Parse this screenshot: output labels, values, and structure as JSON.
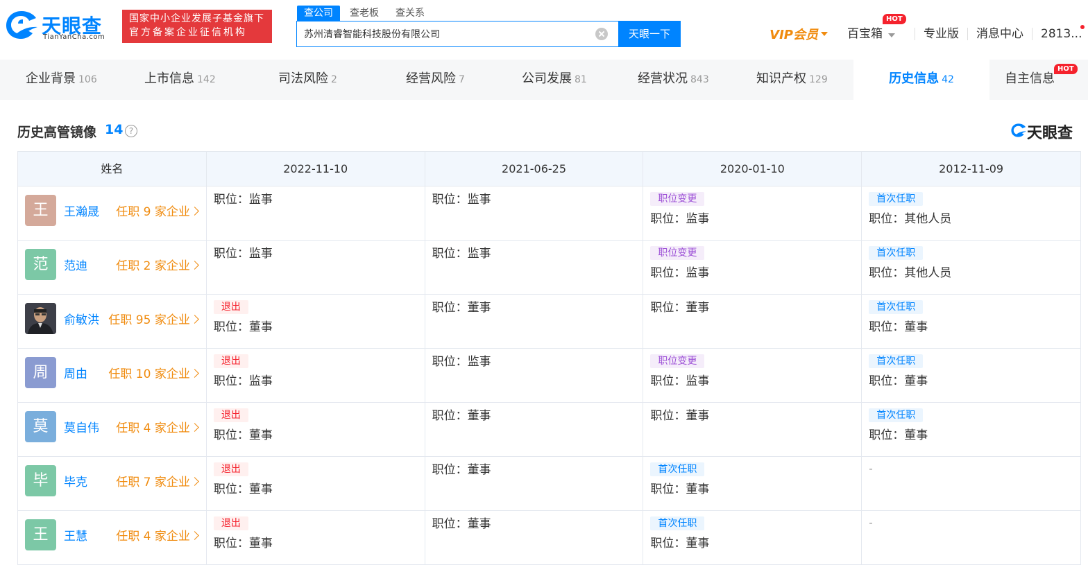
{
  "header": {
    "logo_cn": "天眼查",
    "logo_en": "TianYanCha.com",
    "gov_badge_line1": "国家中小企业发展子基金旗下",
    "gov_badge_line2": "官方备案企业征信机构",
    "search_tabs": [
      "查公司",
      "查老板",
      "查关系"
    ],
    "search_value": "苏州清睿智能科技股份有限公司",
    "search_button": "天眼一下",
    "vip": "VIP会员",
    "treasure": "百宝箱",
    "hot_label": "HOT",
    "pro": "专业版",
    "messages": "消息中心",
    "user": "2813..."
  },
  "tabs": [
    {
      "label": "企业背景",
      "count": "106"
    },
    {
      "label": "上市信息",
      "count": "142"
    },
    {
      "label": "司法风险",
      "count": "2"
    },
    {
      "label": "经营风险",
      "count": "7"
    },
    {
      "label": "公司发展",
      "count": "81"
    },
    {
      "label": "经营状况",
      "count": "843"
    },
    {
      "label": "知识产权",
      "count": "129"
    },
    {
      "label": "历史信息",
      "count": "42"
    },
    {
      "label": "自主信息",
      "count": ""
    }
  ],
  "section": {
    "title": "历史高管镜像",
    "count": "14",
    "help": "?",
    "brand": "天眼查"
  },
  "table": {
    "headers": [
      "姓名",
      "2022-11-10",
      "2021-06-25",
      "2020-01-10",
      "2012-11-09"
    ],
    "rows": [
      {
        "avatar_char": "王",
        "avatar_color": "#d4a99a",
        "name": "王瀚晟",
        "jobs": "任职 9 家企业",
        "cells": [
          {
            "tag": "",
            "pos": "职位：监事"
          },
          {
            "tag": "",
            "pos": "职位：监事"
          },
          {
            "tag": "职位变更",
            "pos": "职位：监事"
          },
          {
            "tag": "首次任职",
            "pos": "职位：其他人员"
          }
        ]
      },
      {
        "avatar_char": "范",
        "avatar_color": "#7cc8a6",
        "name": "范迪",
        "jobs": "任职 2 家企业",
        "cells": [
          {
            "tag": "",
            "pos": "职位：监事"
          },
          {
            "tag": "",
            "pos": "职位：监事"
          },
          {
            "tag": "职位变更",
            "pos": "职位：监事"
          },
          {
            "tag": "首次任职",
            "pos": "职位：其他人员"
          }
        ]
      },
      {
        "avatar_char": "",
        "avatar_color": "#4a4a55",
        "name": "俞敏洪",
        "jobs": "任职 95 家企业",
        "cells": [
          {
            "tag": "退出",
            "pos": "职位：董事"
          },
          {
            "tag": "",
            "pos": "职位：董事"
          },
          {
            "tag": "",
            "pos": "职位：董事"
          },
          {
            "tag": "首次任职",
            "pos": "职位：董事"
          }
        ]
      },
      {
        "avatar_char": "周",
        "avatar_color": "#8a9bd1",
        "name": "周由",
        "jobs": "任职 10 家企业",
        "cells": [
          {
            "tag": "退出",
            "pos": "职位：监事"
          },
          {
            "tag": "",
            "pos": "职位：监事"
          },
          {
            "tag": "职位变更",
            "pos": "职位：监事"
          },
          {
            "tag": "首次任职",
            "pos": "职位：董事"
          }
        ]
      },
      {
        "avatar_char": "莫",
        "avatar_color": "#7aaedc",
        "name": "莫自伟",
        "jobs": "任职 4 家企业",
        "cells": [
          {
            "tag": "退出",
            "pos": "职位：董事"
          },
          {
            "tag": "",
            "pos": "职位：董事"
          },
          {
            "tag": "",
            "pos": "职位：董事"
          },
          {
            "tag": "首次任职",
            "pos": "职位：董事"
          }
        ]
      },
      {
        "avatar_char": "毕",
        "avatar_color": "#7cc8a6",
        "name": "毕克",
        "jobs": "任职 7 家企业",
        "cells": [
          {
            "tag": "退出",
            "pos": "职位：董事"
          },
          {
            "tag": "",
            "pos": "职位：董事"
          },
          {
            "tag": "首次任职",
            "pos": "职位：董事"
          },
          {
            "tag": "",
            "pos": "-"
          }
        ]
      },
      {
        "avatar_char": "王",
        "avatar_color": "#7cc8a6",
        "name": "王慧",
        "jobs": "任职 4 家企业",
        "cells": [
          {
            "tag": "退出",
            "pos": "职位：董事"
          },
          {
            "tag": "",
            "pos": "职位：董事"
          },
          {
            "tag": "首次任职",
            "pos": "职位：董事"
          },
          {
            "tag": "",
            "pos": "-"
          }
        ]
      }
    ]
  },
  "tag_colors": {
    "退出": "exit",
    "职位变更": "change",
    "首次任职": "first"
  }
}
